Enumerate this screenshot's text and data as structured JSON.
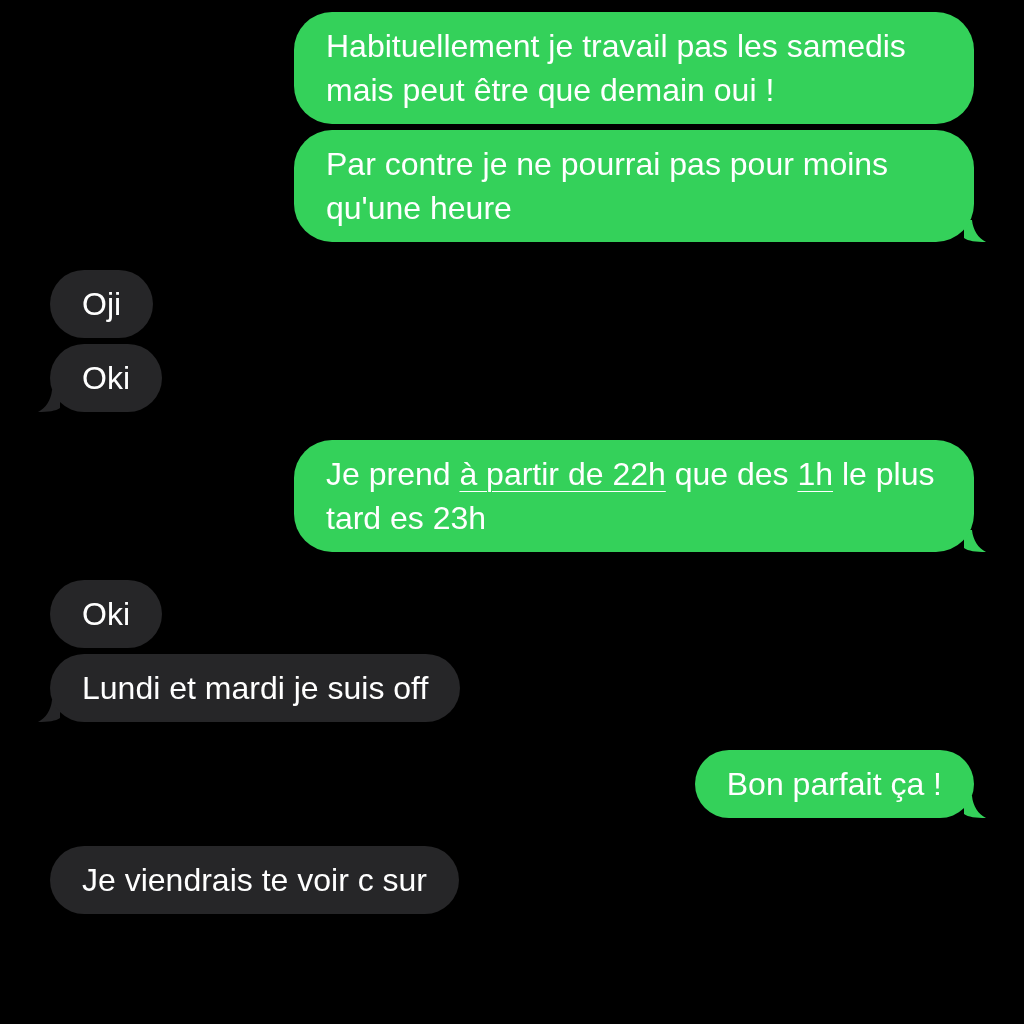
{
  "messages": [
    {
      "kind": "sent",
      "tail": false,
      "parts": [
        {
          "text": "Habituellement je travail pas les samedis mais peut être que demain oui !",
          "link": false
        }
      ]
    },
    {
      "kind": "sent",
      "tail": true,
      "parts": [
        {
          "text": "Par contre je ne pourrai pas pour moins qu'une heure",
          "link": false
        }
      ]
    },
    {
      "kind": "received",
      "tail": false,
      "parts": [
        {
          "text": "Oji",
          "link": false
        }
      ]
    },
    {
      "kind": "received",
      "tail": true,
      "parts": [
        {
          "text": "Oki",
          "link": false
        }
      ]
    },
    {
      "kind": "sent",
      "tail": true,
      "parts": [
        {
          "text": "Je prend ",
          "link": false
        },
        {
          "text": "à partir de 22h",
          "link": true
        },
        {
          "text": " que des ",
          "link": false
        },
        {
          "text": "1h",
          "link": true
        },
        {
          "text": " le plus tard es 23h",
          "link": false
        }
      ]
    },
    {
      "kind": "received",
      "tail": false,
      "parts": [
        {
          "text": "Oki",
          "link": false
        }
      ]
    },
    {
      "kind": "received",
      "tail": true,
      "parts": [
        {
          "text": "Lundi et mardi je suis off",
          "link": false
        }
      ]
    },
    {
      "kind": "sent",
      "tail": true,
      "parts": [
        {
          "text": "Bon parfait ça !",
          "link": false
        }
      ]
    },
    {
      "kind": "received",
      "tail": false,
      "parts": [
        {
          "text": "Je viendrais te voir c sur",
          "link": false
        }
      ]
    }
  ]
}
